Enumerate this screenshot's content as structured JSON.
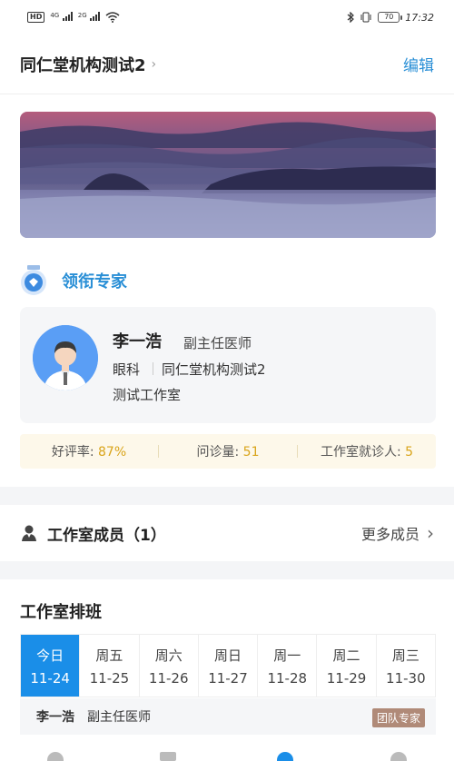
{
  "status_bar": {
    "hd_label": "HD",
    "sim1_label": "4G",
    "sim2_label": "2G",
    "battery": "70",
    "time": "17:32"
  },
  "header": {
    "title": "同仁堂机构测试2",
    "edit_label": "编辑"
  },
  "lead": {
    "section_title": "领衔专家",
    "doctor": {
      "name": "李一浩",
      "title": "副主任医师",
      "department": "眼科",
      "organization": "同仁堂机构测试2",
      "studio": "测试工作室"
    },
    "stats": [
      {
        "label": "好评率: ",
        "value": "87%"
      },
      {
        "label": "问诊量: ",
        "value": "51"
      },
      {
        "label": "工作室就诊人: ",
        "value": "5"
      }
    ]
  },
  "members": {
    "title": "工作室成员（1）",
    "more_label": "更多成员"
  },
  "schedule": {
    "title": "工作室排班",
    "days": [
      {
        "weekday": "今日",
        "date": "11-24",
        "active": true
      },
      {
        "weekday": "周五",
        "date": "11-25"
      },
      {
        "weekday": "周六",
        "date": "11-26"
      },
      {
        "weekday": "周日",
        "date": "11-27"
      },
      {
        "weekday": "周一",
        "date": "11-28"
      },
      {
        "weekday": "周二",
        "date": "11-29"
      },
      {
        "weekday": "周三",
        "date": "11-30"
      }
    ],
    "entry": {
      "name": "李一浩",
      "title": "副主任医师",
      "badge": "团队专家"
    }
  },
  "colors": {
    "accent": "#2a8fd6",
    "active_day": "#1a8ee8",
    "stat_value": "#d9a41a",
    "badge": "#b08a78"
  },
  "icons": [
    "wifi-icon",
    "bluetooth-icon",
    "vibrate-icon",
    "battery-icon",
    "chevron-right-icon",
    "medal-icon",
    "avatar",
    "member-icon"
  ]
}
